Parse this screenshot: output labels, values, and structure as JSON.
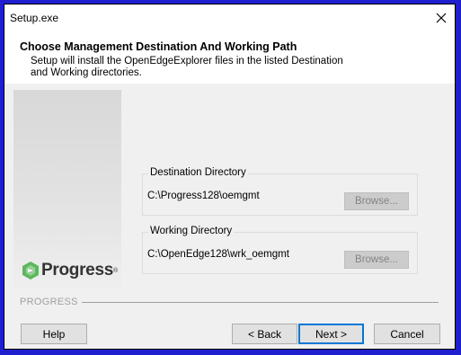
{
  "window": {
    "title": "Setup.exe"
  },
  "header": {
    "title": "Choose Management Destination And Working Path",
    "subtitle": "Setup will install the OpenEdgeExplorer files in the listed Destination and Working directories."
  },
  "banner": {
    "logo_text": "Progress",
    "logo_reg": "®",
    "brand_label": "PROGRESS"
  },
  "destination": {
    "label": "Destination Directory",
    "path": "C:\\Progress128\\oemgmt",
    "browse_label": "Browse..."
  },
  "working": {
    "label": "Working Directory",
    "path": "C:\\OpenEdge128\\wrk_oemgmt",
    "browse_label": "Browse..."
  },
  "footer": {
    "help_label": "Help",
    "back_label": "< Back",
    "next_label": "Next >",
    "cancel_label": "Cancel"
  },
  "colors": {
    "background": "#1f1fd0",
    "logo_green": "#5cb85c",
    "default_border": "#0078d7"
  }
}
